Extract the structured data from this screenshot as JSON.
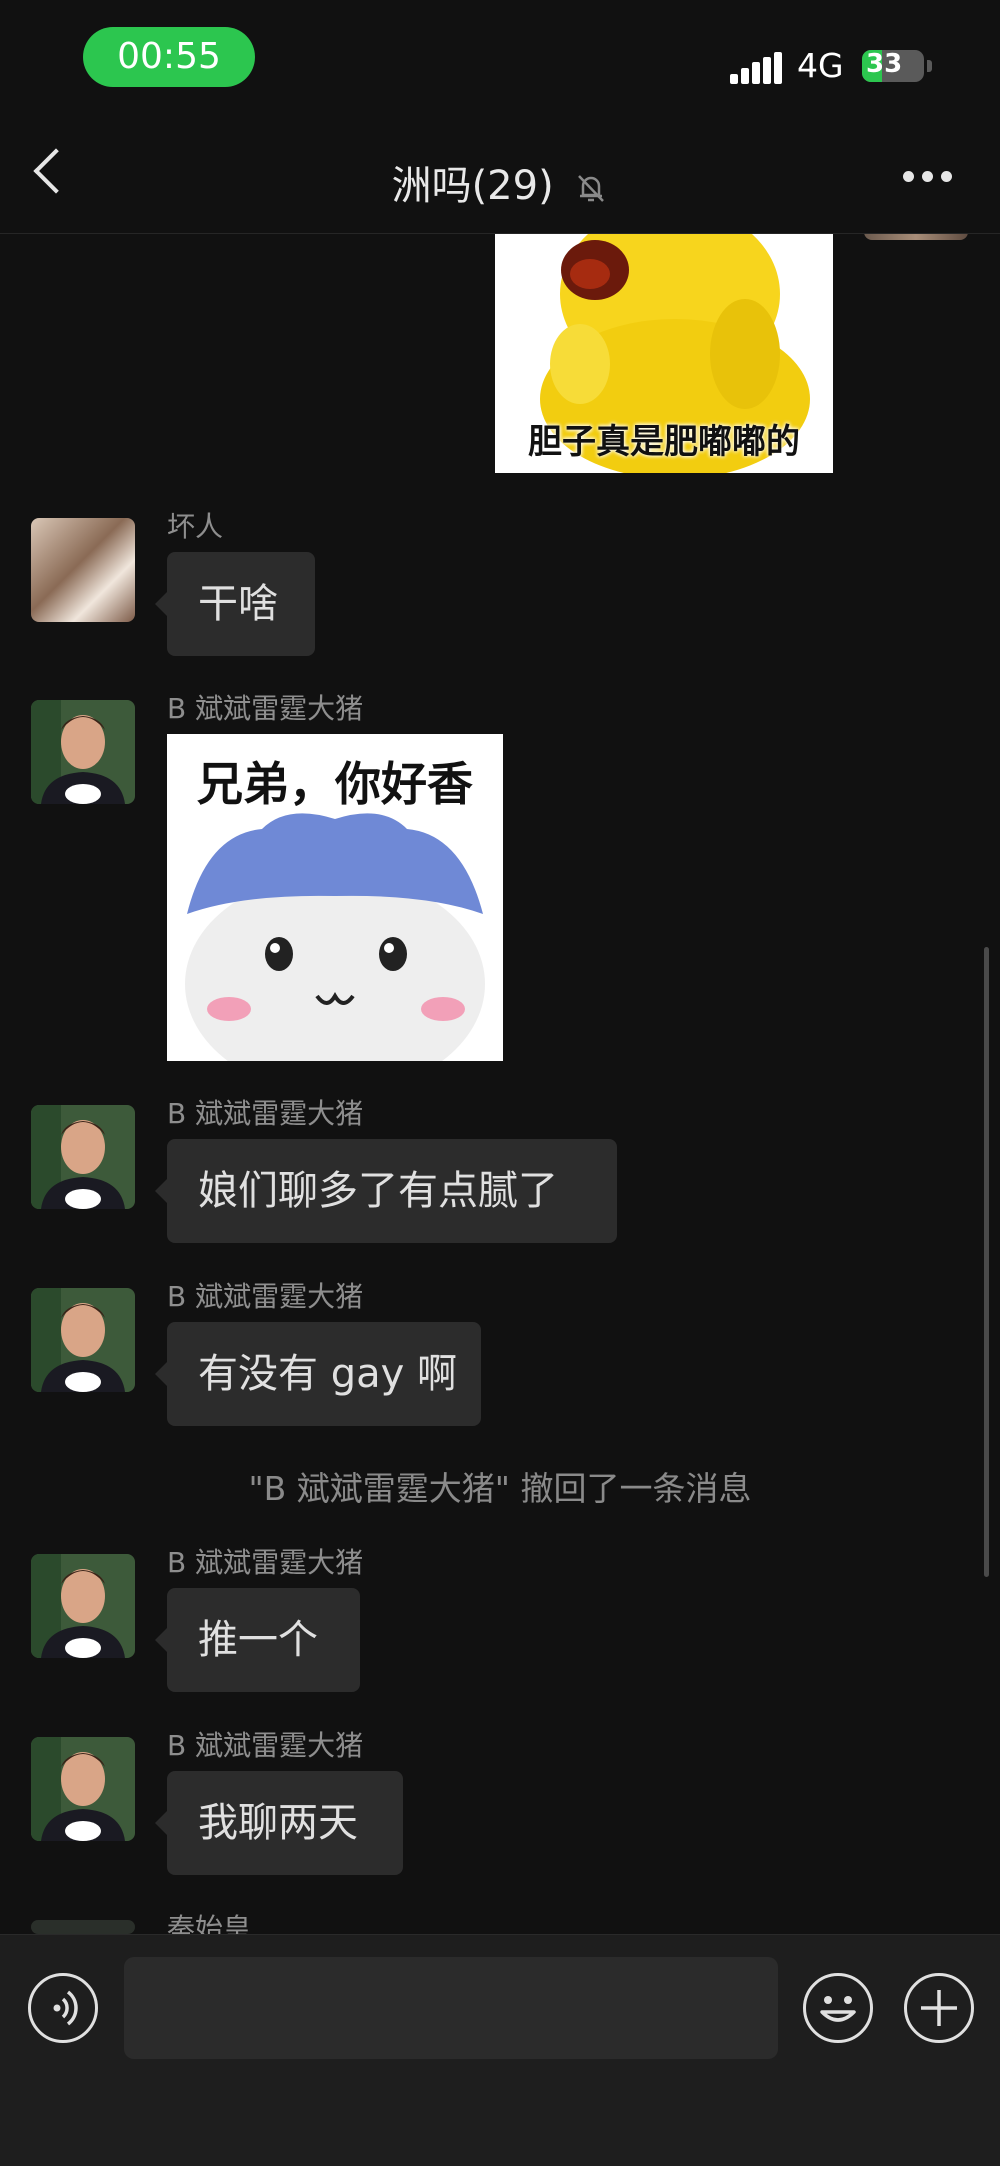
{
  "status_bar": {
    "time": "00:55",
    "network": "4G",
    "battery": "33",
    "battery_level": 0.33
  },
  "nav": {
    "title": "洲吗(29)"
  },
  "stickers": {
    "pikachu_caption": "胆子真是肥嘟嘟的",
    "chiikawa_caption": "兄弟，你好香"
  },
  "messages": [
    {
      "sender": "坏人",
      "text": "干啥"
    },
    {
      "sender": "B 斌斌雷霆大猪"
    },
    {
      "sender": "B 斌斌雷霆大猪",
      "text": "娘们聊多了有点腻了"
    },
    {
      "sender": "B 斌斌雷霆大猪",
      "text": "有没有 gay 啊"
    },
    {
      "sender": "B 斌斌雷霆大猪",
      "text": "推一个"
    },
    {
      "sender": "B 斌斌雷霆大猪",
      "text": "我聊两天"
    },
    {
      "sender": "秦始皇"
    }
  ],
  "system_message": "\"B 斌斌雷霆大猪\" 撤回了一条消息",
  "input": {
    "placeholder": ""
  },
  "colors": {
    "accent": "#2cc64f",
    "bubble": "#2c2c2c",
    "background": "#111111"
  }
}
